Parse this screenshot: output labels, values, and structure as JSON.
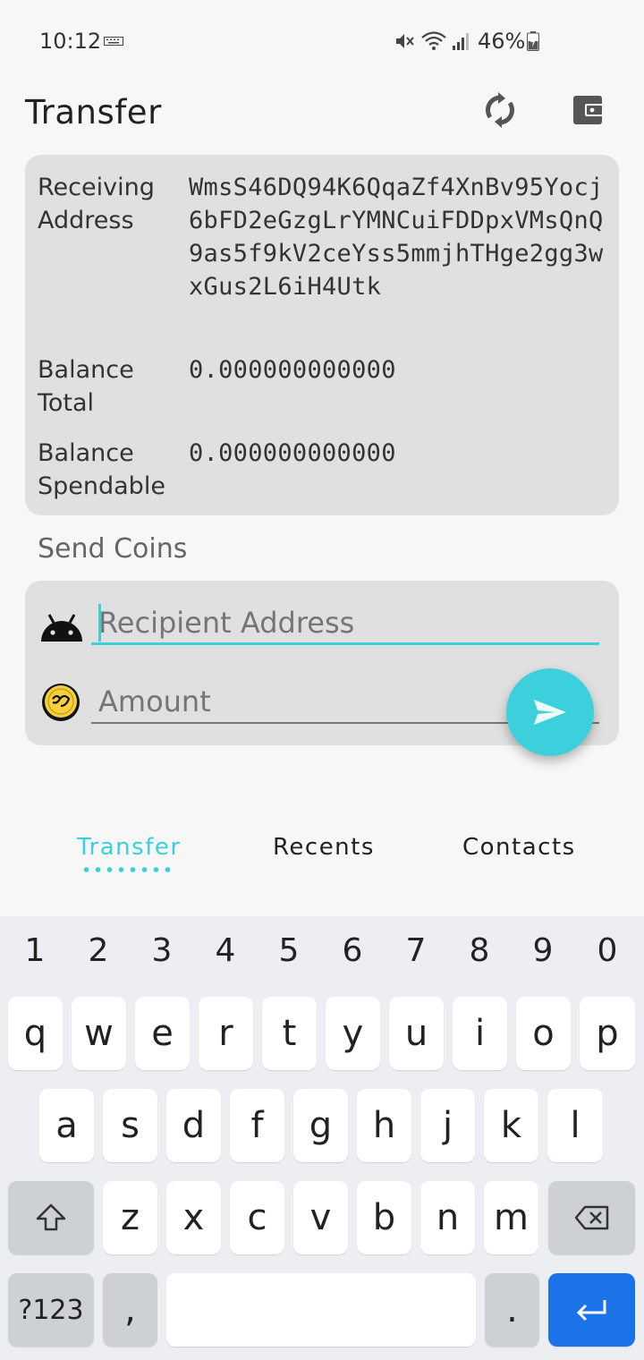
{
  "status_bar": {
    "time": "10:12",
    "battery_percent": "46%",
    "icons": [
      "keyboard-icon",
      "mute-icon",
      "wifi-icon",
      "signal-icon",
      "battery-charging-icon"
    ]
  },
  "header": {
    "title": "Transfer",
    "icons": [
      "sync-icon",
      "wallet-icon"
    ]
  },
  "wallet": {
    "receiving_address_label": "Receiving Address",
    "receiving_address": "WmsS46DQ94K6QqaZf4XnBv95Yocj6bFD2eGzgLrYMNCuiFDDpxVMsQnQ9as5f9kV2ceYss5mmjhTHge2gg3wxGus2L6iH4Utk",
    "balance_total_label": "Balance Total",
    "balance_total": "0.000000000000",
    "balance_spendable_label": "Balance Spendable",
    "balance_spendable": "0.000000000000"
  },
  "send": {
    "section_title": "Send Coins",
    "recipient_placeholder": "Recipient Address",
    "amount_placeholder": "Amount",
    "icons": [
      "android-icon",
      "coin-icon",
      "send-icon"
    ]
  },
  "tabs": [
    {
      "label": "Transfer",
      "active": true
    },
    {
      "label": "Recents",
      "active": false
    },
    {
      "label": "Contacts",
      "active": false
    }
  ],
  "colors": {
    "accent": "#3ccfdc",
    "card": "#e0e0e0",
    "background": "#f7f7f7",
    "keyboard_enter": "#1a73e8"
  },
  "keyboard": {
    "numbers": [
      "1",
      "2",
      "3",
      "4",
      "5",
      "6",
      "7",
      "8",
      "9",
      "0"
    ],
    "row1": [
      "q",
      "w",
      "e",
      "r",
      "t",
      "y",
      "u",
      "i",
      "o",
      "p"
    ],
    "row2": [
      "a",
      "s",
      "d",
      "f",
      "g",
      "h",
      "j",
      "k",
      "l"
    ],
    "row3": [
      "z",
      "x",
      "c",
      "v",
      "b",
      "n",
      "m"
    ],
    "symbols_label": "?123",
    "comma": ",",
    "period": "."
  }
}
